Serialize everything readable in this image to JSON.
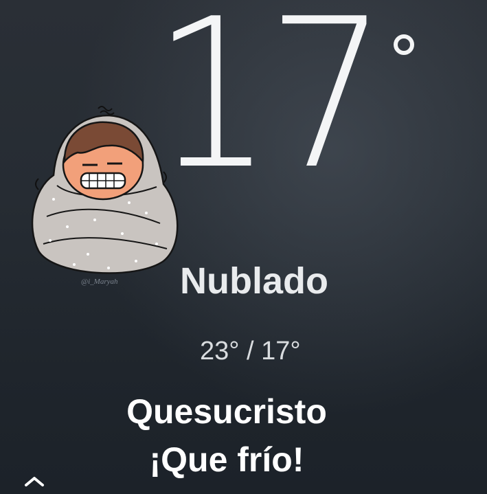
{
  "weather": {
    "temperature": "17",
    "condition": "Nublado",
    "range": "23° / 17°"
  },
  "caption": {
    "line1": "Quesucristo",
    "line2": "¡Que frío!"
  },
  "sticker": {
    "signature": "@i_Maryah",
    "icon": "cold-person-blanket"
  },
  "nav": {
    "icon": "chevron-up-icon"
  },
  "colors": {
    "background": "#262c33",
    "text": "#ffffff",
    "blanket": "#c9c4c0",
    "skin": "#f2a07a",
    "hair": "#7a4a35"
  }
}
